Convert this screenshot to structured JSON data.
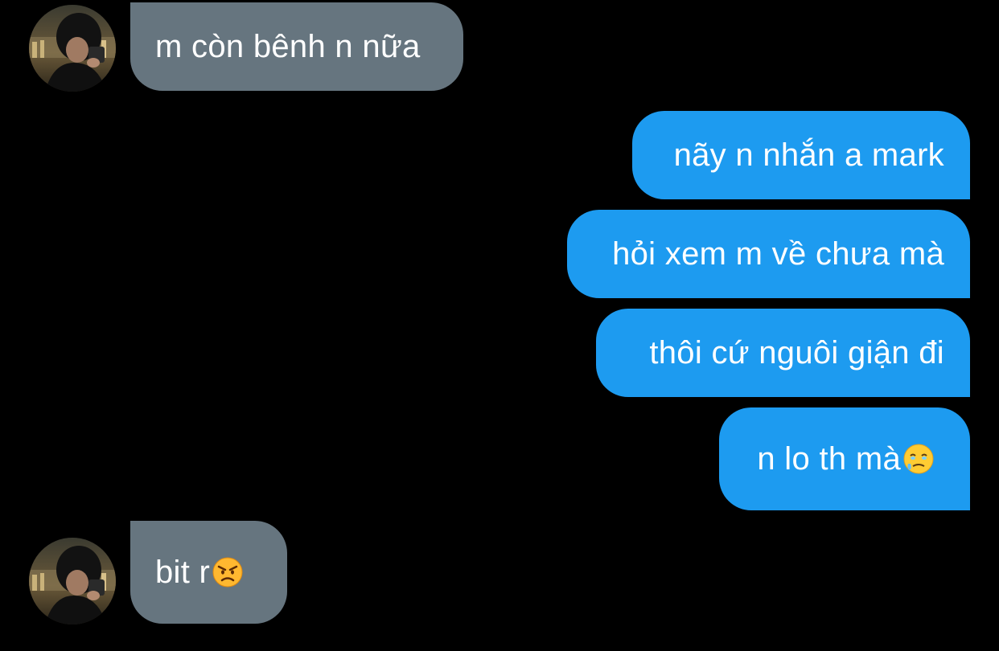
{
  "conversation": {
    "messages": [
      {
        "direction": "incoming",
        "text": "m còn bênh n nữa"
      },
      {
        "direction": "outgoing",
        "text": "nãy n nhắn a mark"
      },
      {
        "direction": "outgoing",
        "text": "hỏi xem m về chưa mà"
      },
      {
        "direction": "outgoing",
        "text": "thôi cứ nguôi giận đi"
      },
      {
        "direction": "outgoing",
        "text": "n lo th mà",
        "emoji": "face-holding-back-tears"
      },
      {
        "direction": "incoming",
        "text": "bit r",
        "emoji": "angry-face"
      }
    ]
  },
  "colors": {
    "background": "#000000",
    "incoming_bubble": "#66757f",
    "outgoing_bubble": "#1d9bf0",
    "text": "#ffffff"
  },
  "icons": {
    "avatar": "user-avatar",
    "emoji_1": "face-holding-back-tears",
    "emoji_2": "angry-face"
  }
}
